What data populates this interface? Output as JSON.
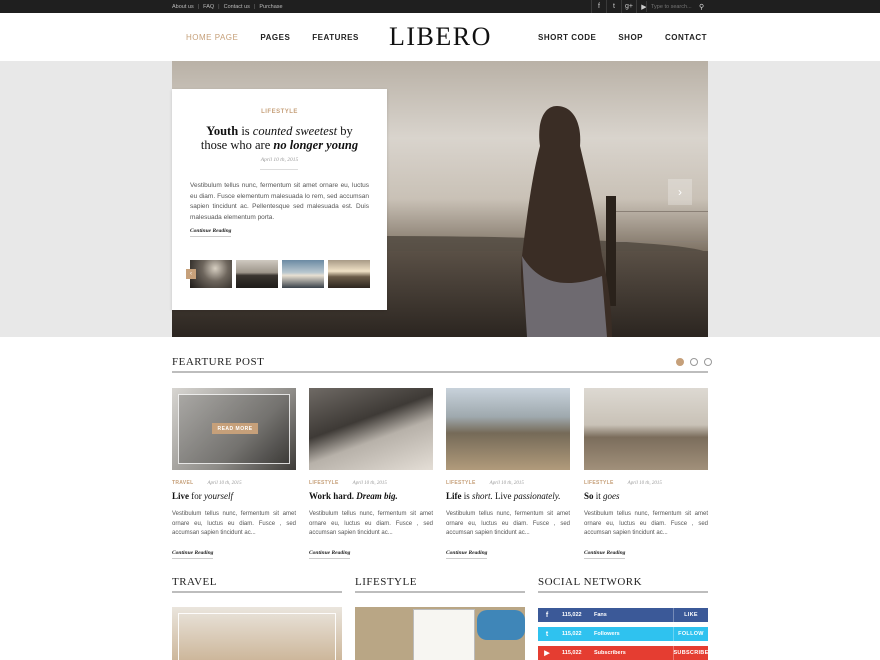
{
  "topbar": {
    "links": [
      "About us",
      "FAQ",
      "Contact us",
      "Purchase"
    ],
    "social_icons": [
      "facebook-icon",
      "twitter-icon",
      "google-plus-icon",
      "youtube-icon"
    ],
    "search_placeholder": "Type to search..."
  },
  "header": {
    "logo": "LIBERO",
    "nav_left": [
      "HOME PAGE",
      "PAGES",
      "FEATURES"
    ],
    "nav_right": [
      "SHORT CODE",
      "SHOP",
      "CONTACT"
    ]
  },
  "hero": {
    "category": "LIFESTYLE",
    "title_parts": {
      "a": "Youth",
      "b": " is ",
      "c": "counted sweetest",
      "d": " by those who are ",
      "e": "no longer young"
    },
    "date": "April 10 th, 2015",
    "excerpt": "Vestibulum tellus nunc, fermentum sit amet ornare eu, luctus eu diam. Fusce elementum malesuada lo rem, sed accumsan sapien tincidunt ac. Pellentesque sed malesuada est. Duis malesuada elementum porta.",
    "more": "Continue Reading"
  },
  "featured": {
    "title": "FEARTURE POST",
    "read_more": "READ MORE",
    "posts": [
      {
        "category": "TRAVEL",
        "date": "April 10 th, 2015",
        "title_a": "Live",
        "title_b": " for ",
        "title_c": "yourself",
        "excerpt": "Vestibulum tellus nunc, fermentum sit amet ornare eu, luctus eu diam. Fusce , sed accumsan sapien tincidunt ac...",
        "more": "Continue Reading"
      },
      {
        "category": "LIFESTYLE",
        "date": "April 10 th, 2015",
        "title_a": "Work hard.",
        "title_b": " ",
        "title_c": "Dream big.",
        "excerpt": "Vestibulum tellus nunc, fermentum sit amet ornare eu, luctus eu diam. Fusce , sed accumsan sapien tincidunt ac...",
        "more": "Continue Reading"
      },
      {
        "category": "LIFESTYLE",
        "date": "April 10 th, 2015",
        "title_a": "Life",
        "title_b": " is ",
        "title_c": "short.",
        "title_d": " Live ",
        "title_e": "passionately.",
        "excerpt": "Vestibulum tellus nunc, fermentum sit amet ornare eu, luctus eu diam. Fusce , sed accumsan sapien tincidunt ac...",
        "more": "Continue Reading"
      },
      {
        "category": "LIFESTYLE",
        "date": "April 10 th, 2015",
        "title_a": "So",
        "title_b": " it ",
        "title_c": "goes",
        "excerpt": "Vestibulum tellus nunc, fermentum sit amet ornare eu, luctus eu diam. Fusce , sed accumsan sapien tincidunt ac...",
        "more": "Continue Reading"
      }
    ]
  },
  "sections": {
    "travel": "TRAVEL",
    "lifestyle": "LIFESTYLE",
    "social": "SOCIAL NETWORK"
  },
  "social": [
    {
      "count": "115,022",
      "label": "Fans",
      "action": "LIKE",
      "icon": "facebook-icon"
    },
    {
      "count": "115,022",
      "label": "Followers",
      "action": "FOLLOW",
      "icon": "twitter-icon"
    },
    {
      "count": "115,022",
      "label": "Subscribers",
      "action": "SUBSCRIBE",
      "icon": "youtube-icon"
    }
  ],
  "colors": {
    "accent": "#c6a07a",
    "facebook": "#3b5998",
    "twitter": "#2fc2ef",
    "youtube": "#e53d31",
    "topbar": "#1f1f1f"
  }
}
